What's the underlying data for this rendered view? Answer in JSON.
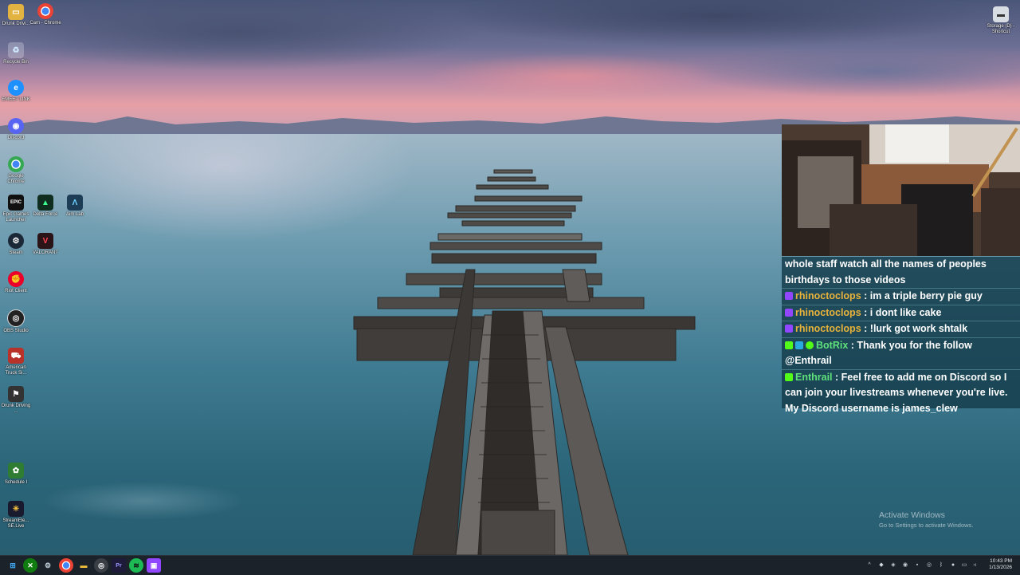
{
  "desktop": {
    "icons": [
      {
        "id": "drunk-drivers-folder",
        "label": "Drunk Drivi...",
        "icon": "folder-icon"
      },
      {
        "id": "cam-chrome",
        "label": "Cam - Chrome",
        "icon": "chrome-icon"
      },
      {
        "id": "recycle-bin",
        "label": "Recycle Bin",
        "icon": "recycle-bin-icon"
      },
      {
        "id": "emeet-link",
        "label": "EMEET LINK",
        "icon": "emeet-icon"
      },
      {
        "id": "discord",
        "label": "Discord",
        "icon": "discord-icon"
      },
      {
        "id": "google-chrome",
        "label": "Google Chrome",
        "icon": "chrome-icon"
      },
      {
        "id": "epic-games",
        "label": "Epic Games Launcher",
        "icon": "epic-games-icon"
      },
      {
        "id": "delta-force",
        "label": "Delta Force",
        "icon": "delta-force-icon"
      },
      {
        "id": "aim-lab",
        "label": "Aim Lab",
        "icon": "aim-lab-icon"
      },
      {
        "id": "steam",
        "label": "Steam",
        "icon": "steam-icon"
      },
      {
        "id": "valorant",
        "label": "VALORANT",
        "icon": "valorant-icon"
      },
      {
        "id": "riot-client",
        "label": "Riot Client",
        "icon": "riot-client-icon"
      },
      {
        "id": "obs-studio",
        "label": "OBS Studio",
        "icon": "obs-icon"
      },
      {
        "id": "american-truck",
        "label": "American Truck Si...",
        "icon": "truck-icon"
      },
      {
        "id": "drunk-driving",
        "label": "Drunk Driving ...",
        "icon": "drunk-driving-icon"
      },
      {
        "id": "schedule-i",
        "label": "Schedule I",
        "icon": "schedule-i-icon"
      },
      {
        "id": "streamelements",
        "label": "StreamEle... SE.Live",
        "icon": "streamelements-icon"
      },
      {
        "id": "storage-shortcut",
        "label": "Storage (D) - Shortcut",
        "icon": "drive-icon"
      }
    ]
  },
  "chat": {
    "messages": [
      {
        "user": "",
        "text": "whole staff watch all the names of peoples birthdays to those videos",
        "platform": "",
        "badges": []
      },
      {
        "user": "rhinoctoclops",
        "text": ": im a triple berry pie guy",
        "platform": "twitch",
        "badges": [
          "twitch-icon"
        ]
      },
      {
        "user": "rhinoctoclops",
        "text": ": i dont like cake",
        "platform": "twitch",
        "badges": [
          "twitch-icon"
        ]
      },
      {
        "user": "rhinoctoclops",
        "text": ": !lurk got work shtalk",
        "platform": "twitch",
        "badges": [
          "twitch-icon"
        ]
      },
      {
        "user": "BotRix",
        "text": ": Thank you for the follow @Enthrail",
        "platform": "kick",
        "badges": [
          "kick-icon",
          "bot-icon",
          "verified-icon"
        ]
      },
      {
        "user": "Enthrail",
        "text": ": Feel free to add me on Discord so I can join your livestreams whenever you're live. My Discord username is james_clew",
        "platform": "kick",
        "badges": [
          "kick-icon"
        ]
      }
    ]
  },
  "watermark": {
    "title": "Activate Windows",
    "subtitle": "Go to Settings to activate Windows."
  },
  "taskbar": {
    "apps": [
      "windows-start-icon",
      "xbox-icon",
      "steam-icon",
      "chrome-icon",
      "file-explorer-icon",
      "obs-icon",
      "premiere-pro-icon",
      "spotify-icon",
      "twitch-icon"
    ],
    "clock_time": "10:43 PM",
    "clock_date": "1/13/2026"
  },
  "colors": {
    "twitch_badge": "#9146ff",
    "kick_badge": "#53fc18",
    "twitch_user": "#e8b33a",
    "kick_user": "#5ee07a",
    "chat_bg": "#143c4b"
  }
}
